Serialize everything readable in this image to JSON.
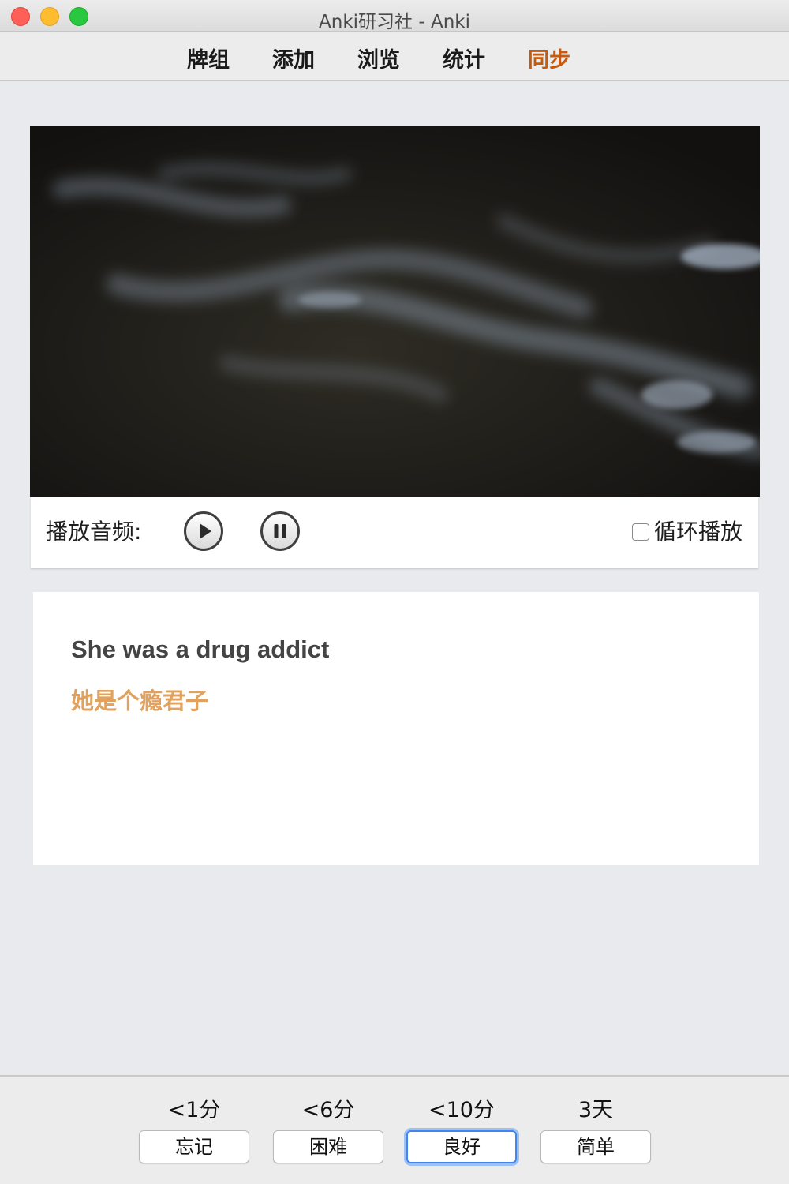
{
  "window": {
    "title": "Anki研习社 - Anki"
  },
  "toolbar": {
    "tabs": [
      {
        "label": "牌组"
      },
      {
        "label": "添加"
      },
      {
        "label": "浏览"
      },
      {
        "label": "统计"
      },
      {
        "label": "同步",
        "color": "#c55a11"
      }
    ]
  },
  "audio": {
    "label": "播放音频:",
    "play_icon": "play-icon",
    "pause_icon": "pause-icon",
    "loop_label": "循环播放",
    "loop_checked": false
  },
  "card": {
    "sentence_en": "She was a drug addict",
    "sentence_zh": "她是个瘾君子",
    "zh_color": "#e0a25e"
  },
  "answer": {
    "buttons": [
      {
        "time": "<1分",
        "label": "忘记"
      },
      {
        "time": "<6分",
        "label": "困难"
      },
      {
        "time": "<10分",
        "label": "良好",
        "focused": true
      },
      {
        "time": "3天",
        "label": "简单"
      }
    ]
  },
  "colors": {
    "accent_focus": "#3f86f5",
    "background": "#e9eaee"
  }
}
